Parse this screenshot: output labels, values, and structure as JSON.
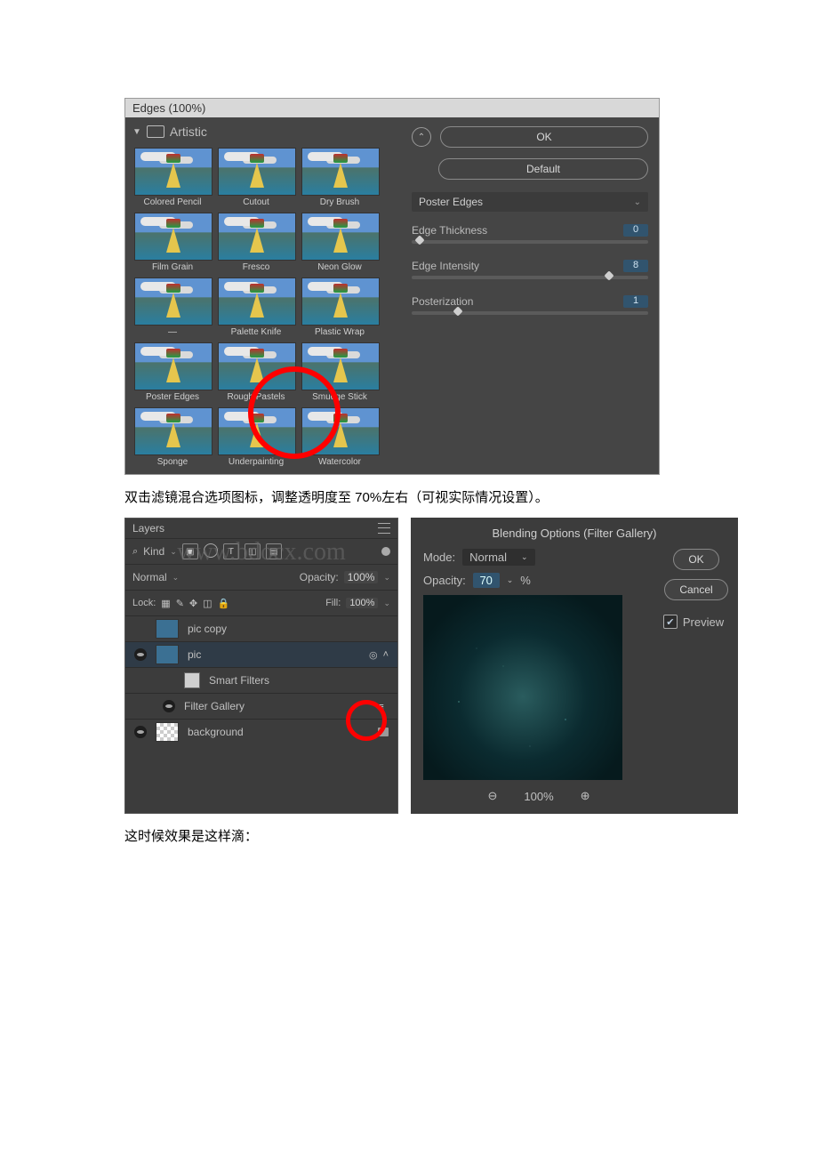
{
  "filter_gallery": {
    "title": "Edges (100%)",
    "category": "Artistic",
    "items": [
      "Colored Pencil",
      "Cutout",
      "Dry Brush",
      "Film Grain",
      "Fresco",
      "Neon Glow",
      "—",
      "Palette Knife",
      "Plastic Wrap",
      "Poster Edges",
      "Rough Pastels",
      "Smudge Stick",
      "Sponge",
      "Underpainting",
      "Watercolor"
    ],
    "buttons": {
      "ok": "OK",
      "default": "Default"
    },
    "selected_filter": "Poster Edges",
    "params": [
      {
        "name": "Edge Thickness",
        "value": "0",
        "pos": 2
      },
      {
        "name": "Edge Intensity",
        "value": "8",
        "pos": 82
      },
      {
        "name": "Posterization",
        "value": "1",
        "pos": 18
      }
    ]
  },
  "text": {
    "line1": "双击滤镜混合选项图标，调整透明度至 70%左右（可视实际情况设置）。",
    "line2": "这时候效果是这样滴："
  },
  "layers_panel": {
    "title": "Layers",
    "kind_label": "Kind",
    "blend_mode": "Normal",
    "opacity_label": "Opacity:",
    "opacity_value": "100%",
    "lock_label": "Lock:",
    "fill_label": "Fill:",
    "fill_value": "100%",
    "layers": [
      {
        "name": "pic copy",
        "visible": false
      },
      {
        "name": "pic",
        "visible": true,
        "selected": true
      },
      {
        "name": "Smart Filters",
        "sub": true
      },
      {
        "name": "Filter Gallery",
        "sub": true,
        "eye": true
      },
      {
        "name": "background",
        "visible": true
      }
    ],
    "watermark": "www.bdocx.com"
  },
  "blending_options": {
    "title": "Blending Options (Filter Gallery)",
    "mode_label": "Mode:",
    "mode_value": "Normal",
    "opacity_label": "Opacity:",
    "opacity_value": "70",
    "opacity_unit": "%",
    "ok": "OK",
    "cancel": "Cancel",
    "preview_label": "Preview",
    "zoom": "100%"
  }
}
